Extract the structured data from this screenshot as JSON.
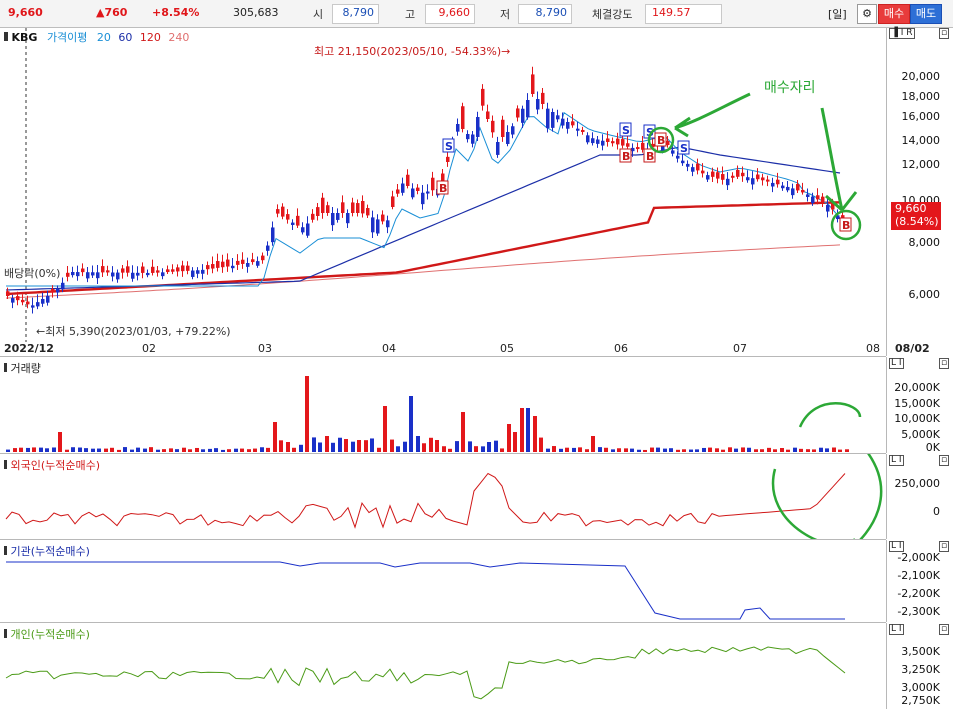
{
  "header": {
    "price": "9,660",
    "change": "▲760",
    "change_pct": "+8.54%",
    "volume": "305,683",
    "open_label": "시",
    "open": "8,790",
    "high_label": "고",
    "high": "9,660",
    "low_label": "저",
    "low": "8,790",
    "strength_label": "체결강도",
    "strength": "149.57",
    "period_btn": "[일]",
    "settings_icon": "gear-icon",
    "buy_btn": "매수",
    "sell_btn": "매도"
  },
  "main_chart": {
    "symbol": "KBG",
    "legend_label": "가격이평",
    "ma_periods": [
      "20",
      "60",
      "120",
      "240"
    ],
    "ma_colors": [
      "#1a8fd6",
      "#1c2fa8",
      "#d01818",
      "#e07070"
    ],
    "high_note": "최고 21,150(2023/05/10, -54.33%)→",
    "low_note": "←최저 5,390(2023/01/03, +79.22%)",
    "dividend_note": "배당락(0%)",
    "annotation_text": "매수자리",
    "y_ticks": [
      "20,000",
      "18,000",
      "16,000",
      "14,000",
      "12,000",
      "10,000",
      "8,000",
      "6,000"
    ],
    "current_price_tag": "9,660",
    "current_pct_tag": "(8.54%)",
    "x_labels": [
      "2022/12",
      "02",
      "03",
      "04",
      "05",
      "06",
      "07",
      "08",
      "08/02"
    ]
  },
  "volume_panel": {
    "title": "거래량",
    "y_ticks": [
      "20,000K",
      "15,000K",
      "10,000K",
      "5,000K",
      "0K"
    ]
  },
  "foreign_panel": {
    "title": "외국인(누적순매수)",
    "y_ticks": [
      "250,000",
      "0"
    ]
  },
  "inst_panel": {
    "title": "기관(누적순매수)",
    "y_ticks": [
      "-2,000K",
      "-2,100K",
      "-2,200K",
      "-2,300K"
    ]
  },
  "retail_panel": {
    "title": "개인(누적순매수)",
    "y_ticks": [
      "3,500K",
      "3,250K",
      "3,000K",
      "2,750K"
    ]
  },
  "signals": {
    "sell_letter": "S",
    "buy_letter": "B"
  }
}
